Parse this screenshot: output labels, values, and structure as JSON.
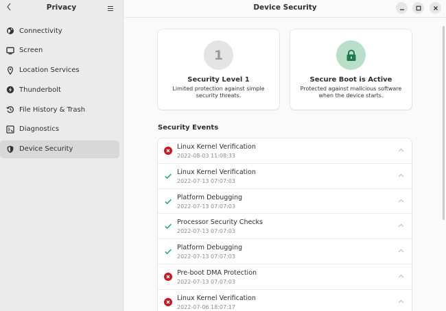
{
  "sidebar": {
    "title": "Privacy",
    "items": [
      {
        "label": "Connectivity",
        "icon": "globe-icon"
      },
      {
        "label": "Screen",
        "icon": "monitor-icon"
      },
      {
        "label": "Location Services",
        "icon": "location-pin-icon"
      },
      {
        "label": "Thunderbolt",
        "icon": "thunderbolt-icon"
      },
      {
        "label": "File History & Trash",
        "icon": "history-icon"
      },
      {
        "label": "Diagnostics",
        "icon": "diagnostics-icon"
      },
      {
        "label": "Device Security",
        "icon": "shield-icon",
        "active": true
      }
    ]
  },
  "header": {
    "title": "Device Security"
  },
  "cards": [
    {
      "badge": "1",
      "title": "Security Level 1",
      "description": "Limited protection against simple security threats."
    },
    {
      "badge_icon": "padlock-icon",
      "title": "Secure Boot is Active",
      "description": "Protected against malicious software when the device starts."
    }
  ],
  "events_section": {
    "title": "Security Events",
    "items": [
      {
        "name": "Linux Kernel Verification",
        "time": "2022-08-03 11:08:33",
        "status": "fail"
      },
      {
        "name": "Linux Kernel Verification",
        "time": "2022-07-13 07:07:03",
        "status": "ok"
      },
      {
        "name": "Platform Debugging",
        "time": "2022-07-13 07:07:03",
        "status": "ok"
      },
      {
        "name": "Processor Security Checks",
        "time": "2022-07-13 07:07:03",
        "status": "ok"
      },
      {
        "name": "Platform Debugging",
        "time": "2022-07-13 07:07:03",
        "status": "ok"
      },
      {
        "name": "Pre-boot DMA Protection",
        "time": "2022-07-13 07:07:03",
        "status": "fail"
      },
      {
        "name": "Linux Kernel Verification",
        "time": "2022-07-06 18:07:17",
        "status": "fail"
      }
    ]
  },
  "colors": {
    "fail": "#c01c28",
    "ok": "#26a269",
    "secure_badge": "#b9dfcb",
    "padlock": "#1f7a4d"
  }
}
